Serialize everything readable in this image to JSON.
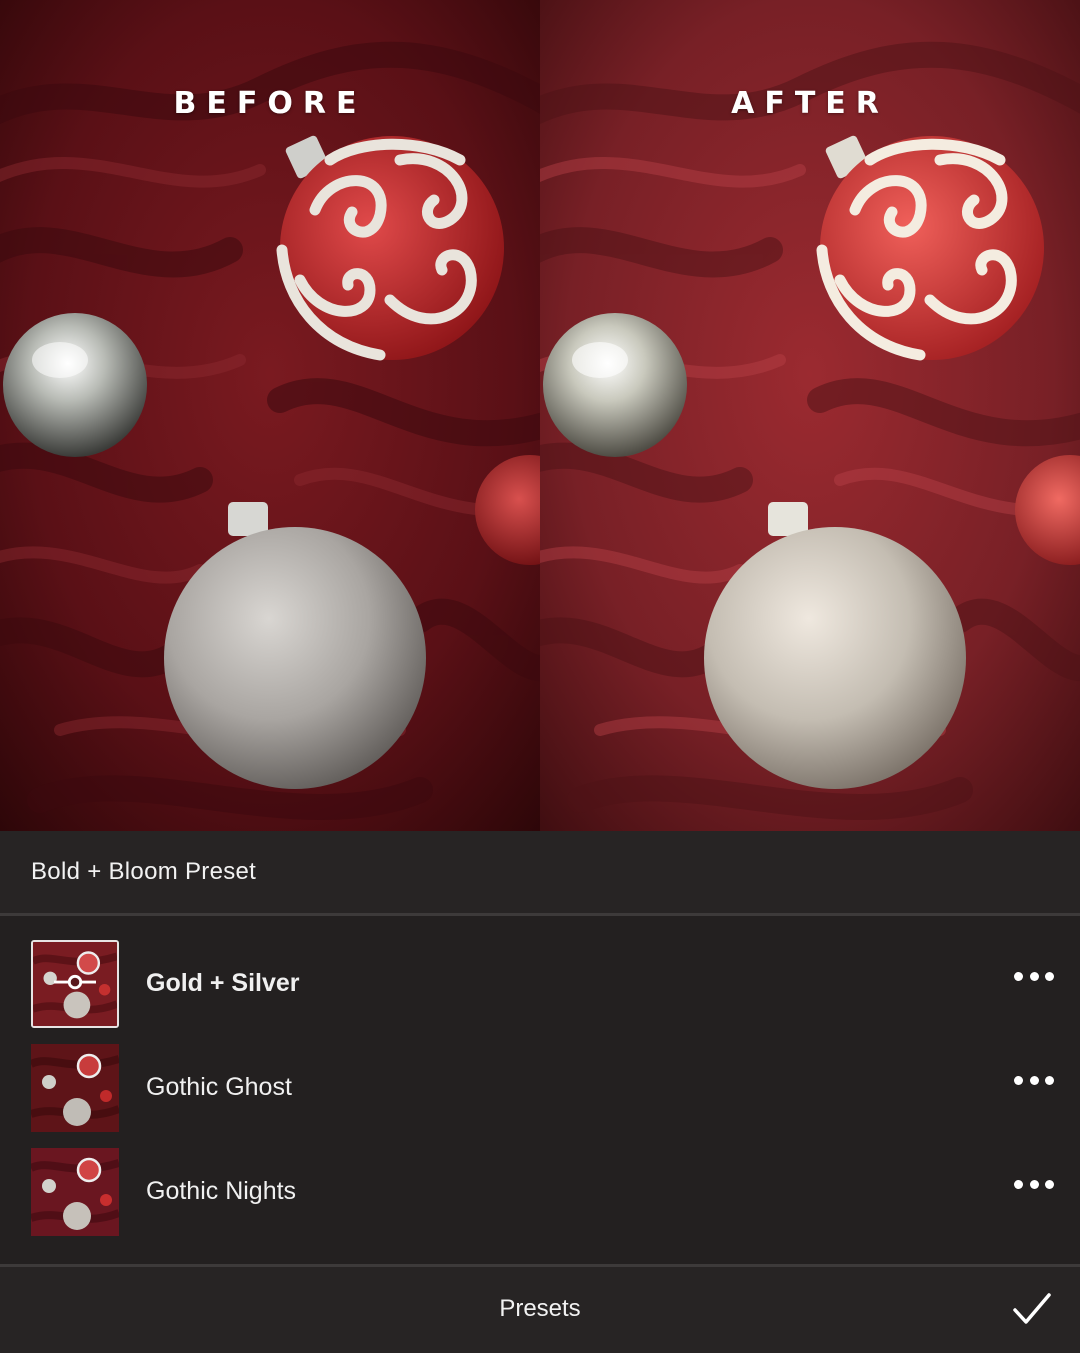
{
  "comparison": {
    "before_label": "BEFORE",
    "after_label": "AFTER"
  },
  "preset_group": {
    "title": "Bold + Bloom Preset"
  },
  "presets": [
    {
      "name": "Gold + Silver",
      "selected": true,
      "icon": "more-horizontal-icon"
    },
    {
      "name": "Gothic Ghost",
      "selected": false,
      "icon": "more-horizontal-icon"
    },
    {
      "name": "Gothic Nights",
      "selected": false,
      "icon": "more-horizontal-icon"
    }
  ],
  "bottom_bar": {
    "title": "Presets",
    "confirm_icon": "checkmark-icon"
  },
  "colors": {
    "panel_background": "#232020",
    "divider": "#3d3a3a",
    "text": "#ffffff",
    "fabric_before": "#6b141a",
    "fabric_after": "#8a2228"
  }
}
